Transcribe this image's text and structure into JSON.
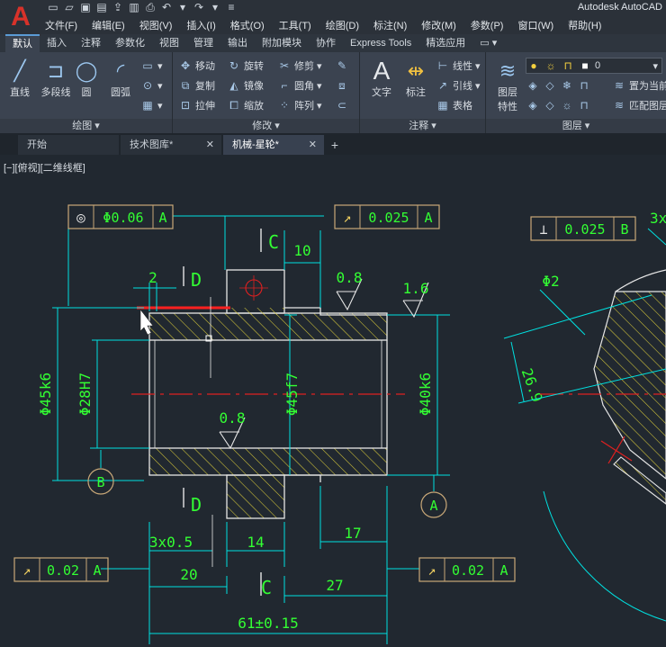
{
  "app": {
    "logo": "A",
    "title": "Autodesk AutoCAD"
  },
  "menu": [
    "文件(F)",
    "编辑(E)",
    "视图(V)",
    "插入(I)",
    "格式(O)",
    "工具(T)",
    "绘图(D)",
    "标注(N)",
    "修改(M)",
    "参数(P)",
    "窗口(W)",
    "帮助(H)"
  ],
  "ribbon_tabs": [
    "默认",
    "插入",
    "注释",
    "参数化",
    "视图",
    "管理",
    "输出",
    "附加模块",
    "协作",
    "Express Tools",
    "精选应用"
  ],
  "ribbon": {
    "draw": {
      "title": "绘图 ▾",
      "line": "直线",
      "polyline": "多段线",
      "circle": "圆",
      "arc": "圆弧"
    },
    "modify": {
      "title": "修改 ▾",
      "move": "移动",
      "rotate": "旋转",
      "trim": "修剪",
      "copy": "复制",
      "mirror": "镜像",
      "fillet": "圆角",
      "stretch": "拉伸",
      "scale": "缩放",
      "array": "阵列"
    },
    "annotation": {
      "title": "注释 ▾",
      "text": "文字",
      "dim": "标注",
      "linear": "线性",
      "leader": "引线",
      "table": "表格"
    },
    "layers": {
      "title": "图层 ▾",
      "props_1": "图层",
      "props_2": "特性",
      "layer_value": "0",
      "set_current": "置为当前",
      "match": "匹配图层"
    }
  },
  "doc_tabs": [
    {
      "label": "开始",
      "active": false,
      "closable": false
    },
    {
      "label": "技术图库*",
      "active": false,
      "closable": true
    },
    {
      "label": "机械-星轮*",
      "active": true,
      "closable": true
    }
  ],
  "viewport_label": "[−][俯视][二维线框]",
  "drawing": {
    "fcf_top_left": {
      "symbol": "◎",
      "tol": "Φ0.06",
      "datum": "A"
    },
    "fcf_top_mid": {
      "symbol": "↗",
      "tol": "0.025",
      "datum": "A"
    },
    "fcf_right": {
      "symbol": "⊥",
      "tol": "0.025",
      "datum": "B"
    },
    "fcf_bottom_left": {
      "symbol": "↗",
      "tol": "0.02",
      "datum": "A"
    },
    "fcf_bottom_right": {
      "symbol": "↗",
      "tol": "0.02",
      "datum": "A"
    },
    "label_C": "C",
    "label_D": "D",
    "dim_10": "10",
    "dim_2": "2",
    "rough_08": "0.8",
    "rough_16": "1.6",
    "dim_d45": "Φ45k6",
    "dim_d28": "Φ28H7",
    "dim_d45f": "Φ45f7",
    "dim_d40": "Φ40k6",
    "datum_B": "B",
    "datum_A": "A",
    "chamfer": "3x0.5",
    "dim_14": "14",
    "dim_17": "17",
    "dim_20": "20",
    "dim_27": "27",
    "dim_61": "61±0.15",
    "dim_phi2": "Φ2",
    "dim_269": "26.9",
    "partial_3x": "3x"
  },
  "colors": {
    "dim": "#00e0e0",
    "text": "#33ff33",
    "frame": "#c9a878",
    "hatch": "#d6c83a",
    "center": "#e02020",
    "canvas": "#212830"
  }
}
